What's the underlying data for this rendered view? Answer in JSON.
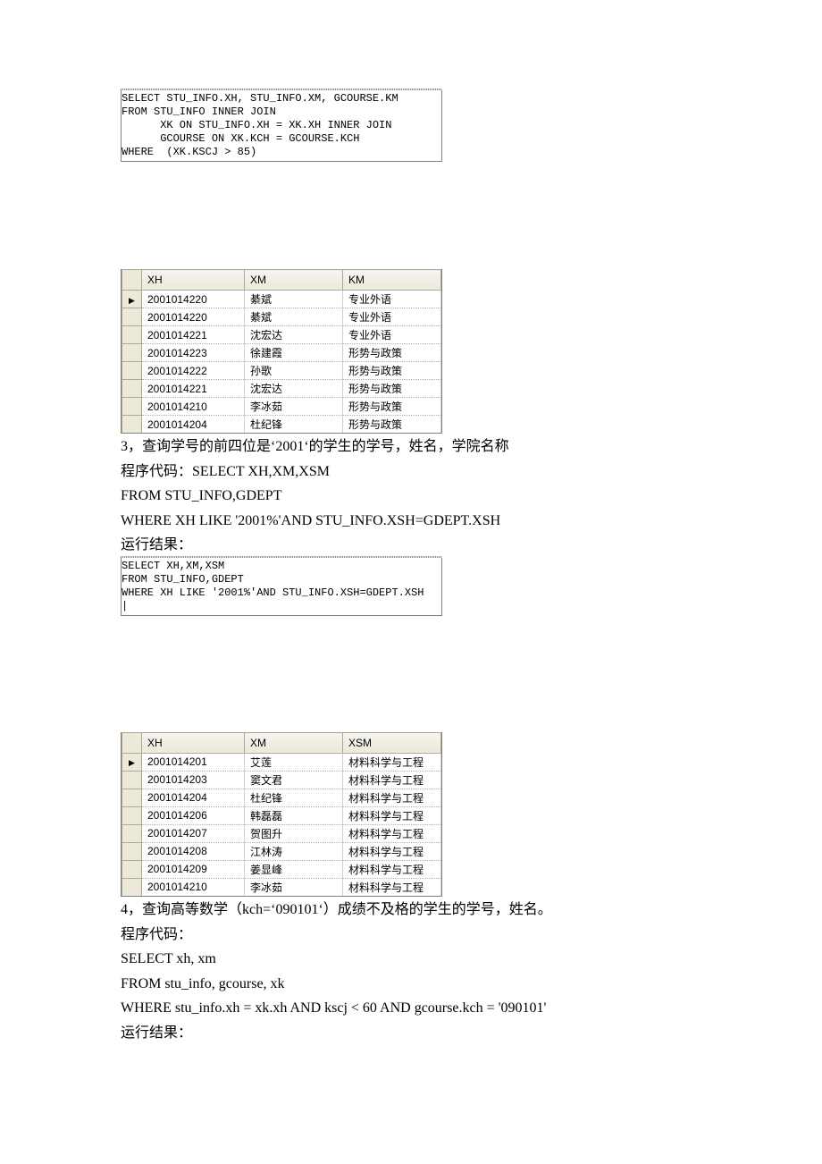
{
  "section1": {
    "sql": "SELECT STU_INFO.XH, STU_INFO.XM, GCOURSE.KM\nFROM STU_INFO INNER JOIN\n      XK ON STU_INFO.XH = XK.XH INNER JOIN\n      GCOURSE ON XK.KCH = GCOURSE.KCH\nWHERE  (XK.KSCJ > 85)",
    "headers": [
      "XH",
      "XM",
      "KM"
    ],
    "rows": [
      [
        "2001014220",
        "綦斌",
        "专业外语"
      ],
      [
        "2001014220",
        "綦斌",
        "专业外语"
      ],
      [
        "2001014221",
        "沈宏达",
        "专业外语"
      ],
      [
        "2001014223",
        "徐建霞",
        "形势与政策"
      ],
      [
        "2001014222",
        "孙歌",
        "形势与政策"
      ],
      [
        "2001014221",
        "沈宏达",
        "形势与政策"
      ],
      [
        "2001014210",
        "李冰茹",
        "形势与政策"
      ],
      [
        "2001014204",
        "杜纪锋",
        "形势与政策"
      ]
    ]
  },
  "q3": {
    "title": "3，查询学号的前四位是‘2001‘的学生的学号，姓名，学院名称",
    "code_label": "程序代码：",
    "code_lines": [
      "SELECT XH,XM,XSM",
      "FROM STU_INFO,GDEPT",
      "WHERE XH LIKE '2001%'AND STU_INFO.XSH=GDEPT.XSH"
    ],
    "result_label": "运行结果："
  },
  "section2": {
    "sql": "SELECT XH,XM,XSM\nFROM STU_INFO,GDEPT\nWHERE XH LIKE '2001%'AND STU_INFO.XSH=GDEPT.XSH\n|",
    "headers": [
      "XH",
      "XM",
      "XSM"
    ],
    "rows": [
      [
        "2001014201",
        "艾莲",
        "材料科学与工程"
      ],
      [
        "2001014203",
        "窦文君",
        "材料科学与工程"
      ],
      [
        "2001014204",
        "杜纪锋",
        "材料科学与工程"
      ],
      [
        "2001014206",
        "韩磊磊",
        "材料科学与工程"
      ],
      [
        "2001014207",
        "贺图升",
        "材料科学与工程"
      ],
      [
        "2001014208",
        "江林涛",
        "材料科学与工程"
      ],
      [
        "2001014209",
        "姜显峰",
        "材料科学与工程"
      ],
      [
        "2001014210",
        "李冰茹",
        "材料科学与工程"
      ]
    ]
  },
  "q4": {
    "title": "4，查询高等数学（kch=‘090101‘）成绩不及格的学生的学号，姓名。",
    "code_label": "程序代码：",
    "code_lines": [
      "SELECT xh, xm",
      "FROM stu_info, gcourse, xk",
      "WHERE stu_info.xh = xk.xh AND kscj < 60 AND gcourse.kch = '090101'"
    ],
    "result_label": "运行结果："
  }
}
